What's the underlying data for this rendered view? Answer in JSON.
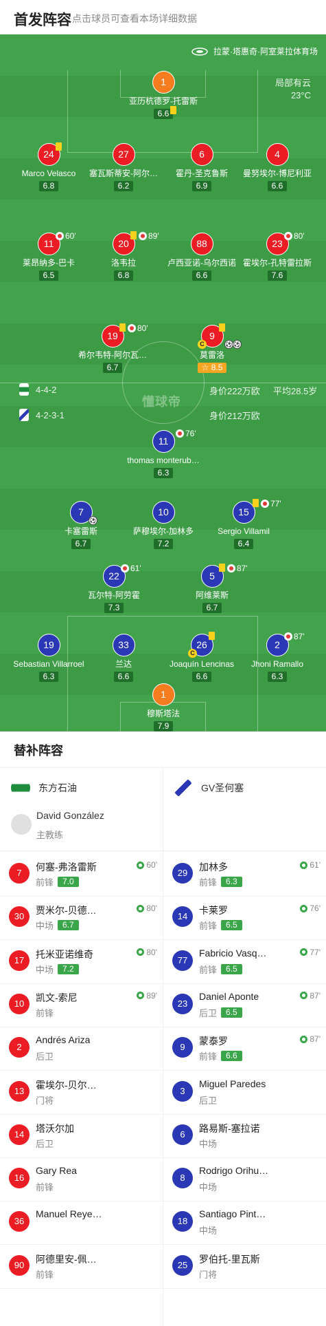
{
  "header": {
    "title": "首发阵容",
    "subtitle": "点击球员可查看本场详细数据"
  },
  "venue": "拉蒙·塔惠奇·阿室莱拉体育场",
  "weather": {
    "condition": "局部有云",
    "temp": "23°C"
  },
  "watermark": "懂球帝",
  "home": {
    "formation": "4-4-2",
    "value": "身价222万欧",
    "age": "平均28.5岁",
    "players": [
      {
        "num": "1",
        "name": "亚历杭德罗-托雷斯",
        "rating": "6.6",
        "gk": true
      },
      {
        "num": "24",
        "name": "Marco Velasco",
        "rating": "6.8"
      },
      {
        "num": "27",
        "name": "塞瓦斯蒂安-阿尔…",
        "rating": "6.2"
      },
      {
        "num": "6",
        "name": "霍丹-圣克鲁斯",
        "rating": "6.9"
      },
      {
        "num": "4",
        "name": "曼努埃尔-博尼利亚",
        "rating": "6.6"
      },
      {
        "num": "11",
        "name": "莱昂纳多-巴卡",
        "rating": "6.5",
        "subOut": "60'"
      },
      {
        "num": "20",
        "name": "洛韦拉",
        "rating": "6.8",
        "subOut": "89'"
      },
      {
        "num": "88",
        "name": "卢西亚诺-乌尔西诺",
        "rating": "6.6"
      },
      {
        "num": "23",
        "name": "霍埃尔-孔特雷拉斯",
        "rating": "7.6",
        "subOut": "80'"
      },
      {
        "num": "19",
        "name": "希尔韦特-阿尔瓦…",
        "rating": "6.7",
        "subOut": "80'"
      },
      {
        "num": "9",
        "name": "莫雷洛",
        "rating": "8.5"
      }
    ]
  },
  "away": {
    "formation": "4-2-3-1",
    "value": "身价212万欧",
    "players": [
      {
        "num": "11",
        "name": "thomas monterub…",
        "rating": "6.3",
        "subOut": "76'"
      },
      {
        "num": "7",
        "name": "卡塞雷斯",
        "rating": "6.7"
      },
      {
        "num": "10",
        "name": "萨穆埃尔-加林多",
        "rating": "7.2"
      },
      {
        "num": "15",
        "name": "Sergio Villamil",
        "rating": "6.4",
        "subOut": "77'"
      },
      {
        "num": "22",
        "name": "瓦尔特-阿劳霍",
        "rating": "7.3",
        "subOut": "61'"
      },
      {
        "num": "5",
        "name": "阿维莱斯",
        "rating": "6.7",
        "subOut": "87'"
      },
      {
        "num": "19",
        "name": "Sebastian Villarroel",
        "rating": "6.3"
      },
      {
        "num": "33",
        "name": "兰达",
        "rating": "6.6"
      },
      {
        "num": "26",
        "name": "Joaquín Lencinas",
        "rating": "6.6"
      },
      {
        "num": "2",
        "name": "Jhoni Ramallo",
        "rating": "6.3",
        "subOut": "87'"
      },
      {
        "num": "1",
        "name": "穆斯塔法",
        "rating": "7.9",
        "gk": true
      }
    ]
  },
  "subs": {
    "title": "替补阵容",
    "homeTeam": "东方石油",
    "awayTeam": "GV圣何塞",
    "coach": {
      "name": "David González",
      "role": "主教练"
    },
    "home": [
      {
        "num": "7",
        "name": "何塞-弗洛雷斯",
        "pos": "前锋",
        "rating": "7.0",
        "min": "60'"
      },
      {
        "num": "30",
        "name": "贾米尔-贝德…",
        "pos": "中场",
        "rating": "6.7",
        "min": "80'"
      },
      {
        "num": "17",
        "name": "托米亚诺维奇",
        "pos": "中场",
        "rating": "7.2",
        "min": "80'"
      },
      {
        "num": "10",
        "name": "凯文-索尼",
        "pos": "前锋",
        "rating": "",
        "min": "89'"
      },
      {
        "num": "2",
        "name": "Andrés Ariza",
        "pos": "后卫",
        "rating": "",
        "min": ""
      },
      {
        "num": "13",
        "name": "霍埃尔-贝尔…",
        "pos": "门将",
        "rating": "",
        "min": ""
      },
      {
        "num": "14",
        "name": "塔沃尔加",
        "pos": "后卫",
        "rating": "",
        "min": ""
      },
      {
        "num": "16",
        "name": "Gary Rea",
        "pos": "前锋",
        "rating": "",
        "min": ""
      },
      {
        "num": "36",
        "name": "Manuel Reye…",
        "pos": "",
        "rating": "",
        "min": ""
      },
      {
        "num": "90",
        "name": "阿德里安-佩…",
        "pos": "前锋",
        "rating": "",
        "min": ""
      }
    ],
    "away": [
      {
        "num": "29",
        "name": "加林多",
        "pos": "前锋",
        "rating": "6.3",
        "min": "61'"
      },
      {
        "num": "14",
        "name": "卡莱罗",
        "pos": "前锋",
        "rating": "6.5",
        "min": "76'"
      },
      {
        "num": "77",
        "name": "Fabricio Vasq…",
        "pos": "前锋",
        "rating": "6.5",
        "min": "77'"
      },
      {
        "num": "23",
        "name": "Daniel Aponte",
        "pos": "后卫",
        "rating": "6.5",
        "min": "87'"
      },
      {
        "num": "9",
        "name": "蒙泰罗",
        "pos": "前锋",
        "rating": "6.6",
        "min": "87'"
      },
      {
        "num": "3",
        "name": "Miguel Paredes",
        "pos": "后卫",
        "rating": "",
        "min": ""
      },
      {
        "num": "6",
        "name": "路易斯-塞拉诺",
        "pos": "中场",
        "rating": "",
        "min": ""
      },
      {
        "num": "8",
        "name": "Rodrigo Orihu…",
        "pos": "中场",
        "rating": "",
        "min": ""
      },
      {
        "num": "18",
        "name": "Santiago Pint…",
        "pos": "中场",
        "rating": "",
        "min": ""
      },
      {
        "num": "25",
        "name": "罗伯托-里瓦斯",
        "pos": "门将",
        "rating": "",
        "min": ""
      }
    ]
  },
  "colors": {
    "pitch": "#3d9b46",
    "home": "#ec1c24",
    "away": "#2b38b6",
    "gk": "#f57c1f",
    "rating": "#3aa64a"
  }
}
